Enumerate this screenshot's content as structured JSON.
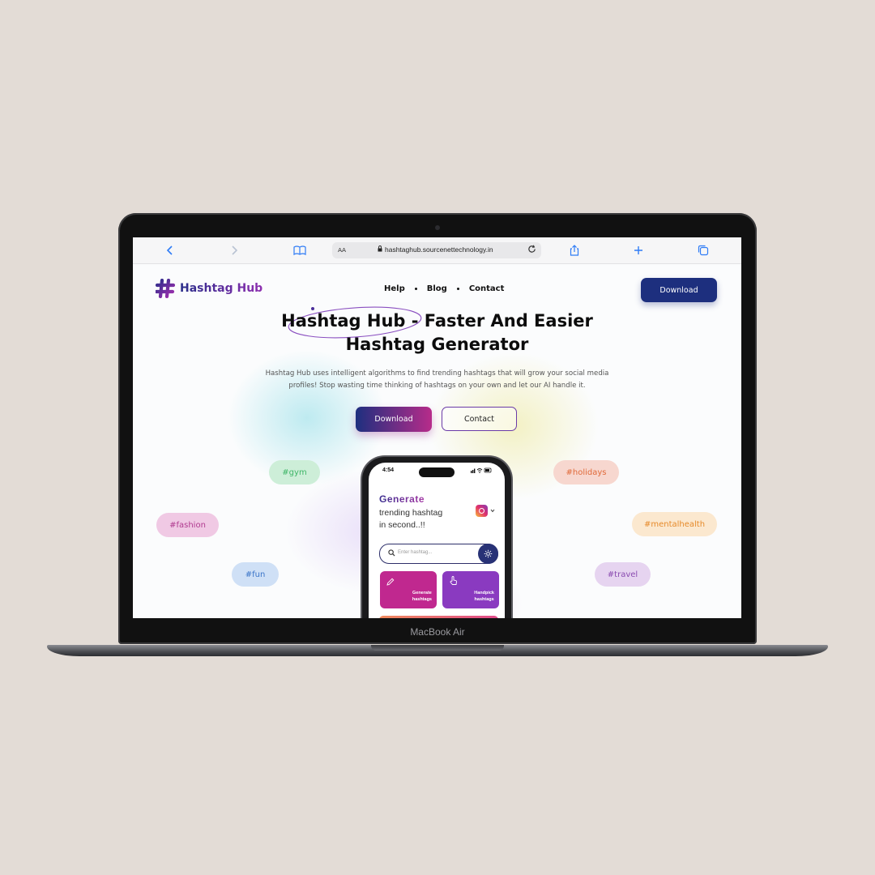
{
  "device": {
    "label": "MacBook Air"
  },
  "browser": {
    "aa_label": "AA",
    "url": "hashtaghub.sourcenettechnology.in",
    "icons": [
      "back-icon",
      "forward-icon",
      "bookmarks-icon",
      "lock-icon",
      "reload-icon",
      "share-icon",
      "new-tab-icon",
      "tabs-icon"
    ]
  },
  "site": {
    "logo": "Hashtag Hub",
    "nav": [
      "Help",
      "Blog",
      "Contact"
    ],
    "top_download": "Download",
    "hero_title_line1": "Hashtag Hub - Faster And Easier",
    "hero_title_line2": "Hashtag Generator",
    "hero_subtitle_line1": "Hashtag Hub uses intelligent algorithms to find trending hashtags that will grow your social media",
    "hero_subtitle_line2": "profiles! Stop wasting time thinking of hashtags on your own and let our AI handle it.",
    "hero_download": "Download",
    "hero_contact": "Contact",
    "tags": [
      "#gym",
      "#fashion",
      "#fun",
      "#holidays",
      "#mentalhealth",
      "#travel"
    ],
    "colors": {
      "brand_navy": "#1d2f7e",
      "brand_magenta": "#b72c8a"
    }
  },
  "phone": {
    "time": "4:54",
    "generate_word": "Generate",
    "tagline_line1": "trending hashtag",
    "tagline_line2": "in second..!!",
    "search_placeholder": "Enter hashtag...",
    "card1_line1": "Generate",
    "card1_line2": "hashtags",
    "card2_line1": "Handpick",
    "card2_line2": "hashtags"
  }
}
